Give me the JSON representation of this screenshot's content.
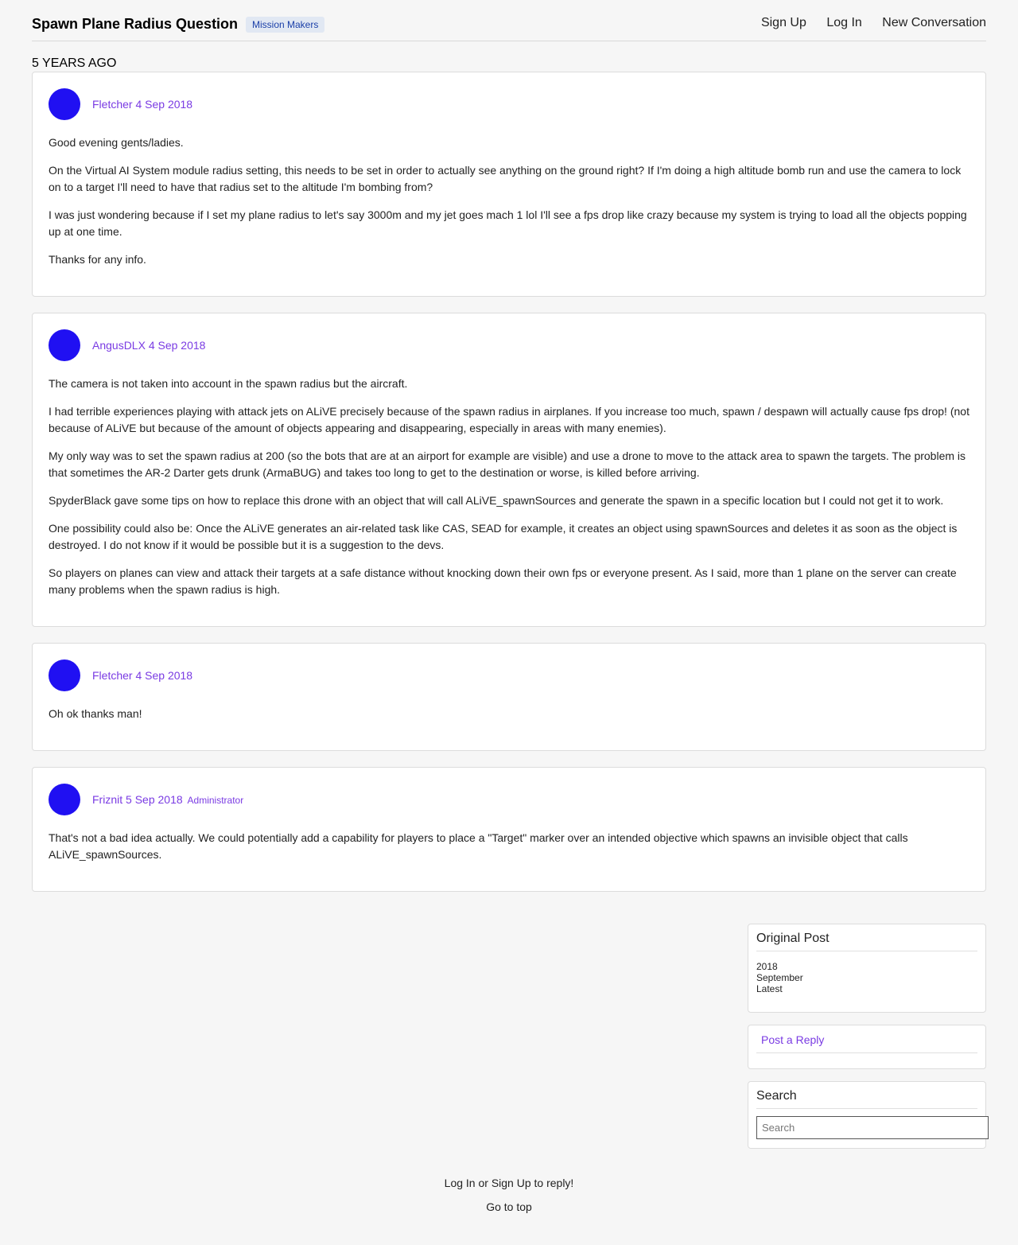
{
  "header": {
    "title": "Spawn Plane Radius Question",
    "tag": "Mission Makers",
    "nav": {
      "sign_up": "Sign Up",
      "log_in": "Log In",
      "new_conversation": "New Conversation"
    }
  },
  "time_divider": "5 YEARS AGO",
  "posts": [
    {
      "author": "Fletcher",
      "date": "4 Sep 2018",
      "role": "",
      "paragraphs": [
        "Good evening gents/ladies.",
        "On the Virtual AI System module radius setting, this needs to be set in order to actually see anything on the ground right? If I'm doing a high altitude bomb run and use the camera to lock on to a target I'll need to have that radius set to the altitude I'm bombing from?",
        "I was just wondering because if I set my plane radius to let's say 3000m and my jet goes mach 1 lol I'll see a fps drop like crazy because my system is trying to load all the objects popping up at one time.",
        "Thanks for any info."
      ]
    },
    {
      "author": "AngusDLX",
      "date": "4 Sep 2018",
      "role": "",
      "paragraphs": [
        "The camera is not taken into account in the spawn radius but the aircraft.",
        "I had terrible experiences playing with attack jets on ALiVE precisely because of the spawn radius in airplanes. If you increase too much, spawn / despawn will actually cause fps drop! (not because of ALiVE but because of the amount of objects appearing and disappearing, especially in areas with many enemies).",
        "My only way was to set the spawn radius at 200 (so the bots that are at an airport for example are visible) and use a drone to move to the attack area to spawn the targets. The problem is that sometimes the AR-2 Darter gets drunk (ArmaBUG) and takes too long to get to the destination or worse, is killed before arriving.",
        "SpyderBlack gave some tips on how to replace this drone with an object that will call ALiVE_spawnSources and generate the spawn in a specific location but I could not get it to work.",
        "One possibility could also be: Once the ALiVE generates an air-related task like CAS, SEAD for example, it creates an object using spawnSources and deletes it as soon as the object is destroyed. I do not know if it would be possible but it is a suggestion to the devs.",
        "So players on planes can view and attack their targets at a safe distance without knocking down their own fps or everyone present. As I said, more than 1 plane on the server can create many problems when the spawn radius is high."
      ]
    },
    {
      "author": "Fletcher",
      "date": "4 Sep 2018",
      "role": "",
      "paragraphs": [
        "Oh ok thanks man!"
      ]
    },
    {
      "author": "Friznit",
      "date": "5 Sep 2018",
      "role": "Administrator",
      "paragraphs": [
        "That's not a bad idea actually. We could potentially add a capability for players to place a \"Target\" marker over an intended objective which spawns an invisible object that calls ALiVE_spawnSources."
      ]
    }
  ],
  "sidebar": {
    "timeline_title": "Original Post",
    "timeline_items": [
      "2018",
      "September",
      "Latest"
    ],
    "reply_label": "Post a Reply",
    "search_title": "Search",
    "search_placeholder": "Search"
  },
  "footer": {
    "login_prompt": "Log In or Sign Up to reply!",
    "go_to_top": "Go to top"
  }
}
